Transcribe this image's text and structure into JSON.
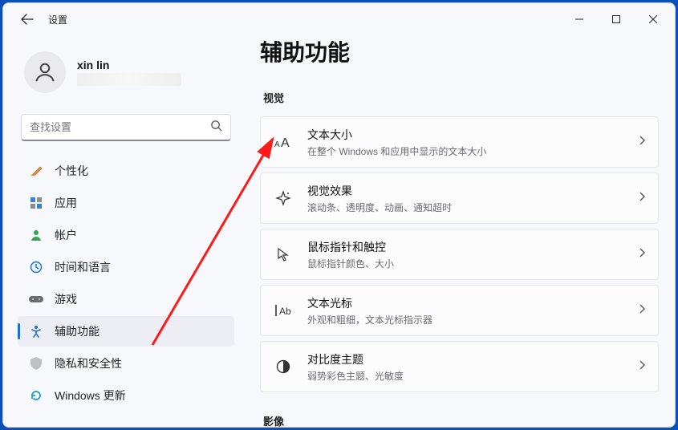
{
  "window": {
    "app_title": "设置",
    "page_title": "辅助功能"
  },
  "account": {
    "name": "xin lin"
  },
  "search": {
    "placeholder": "查找设置"
  },
  "nav": [
    {
      "id": "personalization",
      "label": "个性化"
    },
    {
      "id": "apps",
      "label": "应用"
    },
    {
      "id": "accounts",
      "label": "帐户"
    },
    {
      "id": "time-language",
      "label": "时间和语言"
    },
    {
      "id": "gaming",
      "label": "游戏"
    },
    {
      "id": "accessibility",
      "label": "辅助功能"
    },
    {
      "id": "privacy",
      "label": "隐私和安全性"
    },
    {
      "id": "update",
      "label": "Windows 更新"
    }
  ],
  "sections": {
    "visual_label": "视觉",
    "video_label": "影像"
  },
  "cards": [
    {
      "id": "text-size",
      "title": "文本大小",
      "sub": "在整个 Windows 和应用中显示的文本大小"
    },
    {
      "id": "visual-effects",
      "title": "视觉效果",
      "sub": "滚动条、透明度、动画、通知超时"
    },
    {
      "id": "mouse-touch",
      "title": "鼠标指针和触控",
      "sub": "鼠标指针颜色、大小"
    },
    {
      "id": "text-cursor",
      "title": "文本光标",
      "sub": "外观和粗细，文本光标指示器"
    },
    {
      "id": "contrast",
      "title": "对比度主题",
      "sub": "弱势彩色主题、光敏度"
    }
  ]
}
